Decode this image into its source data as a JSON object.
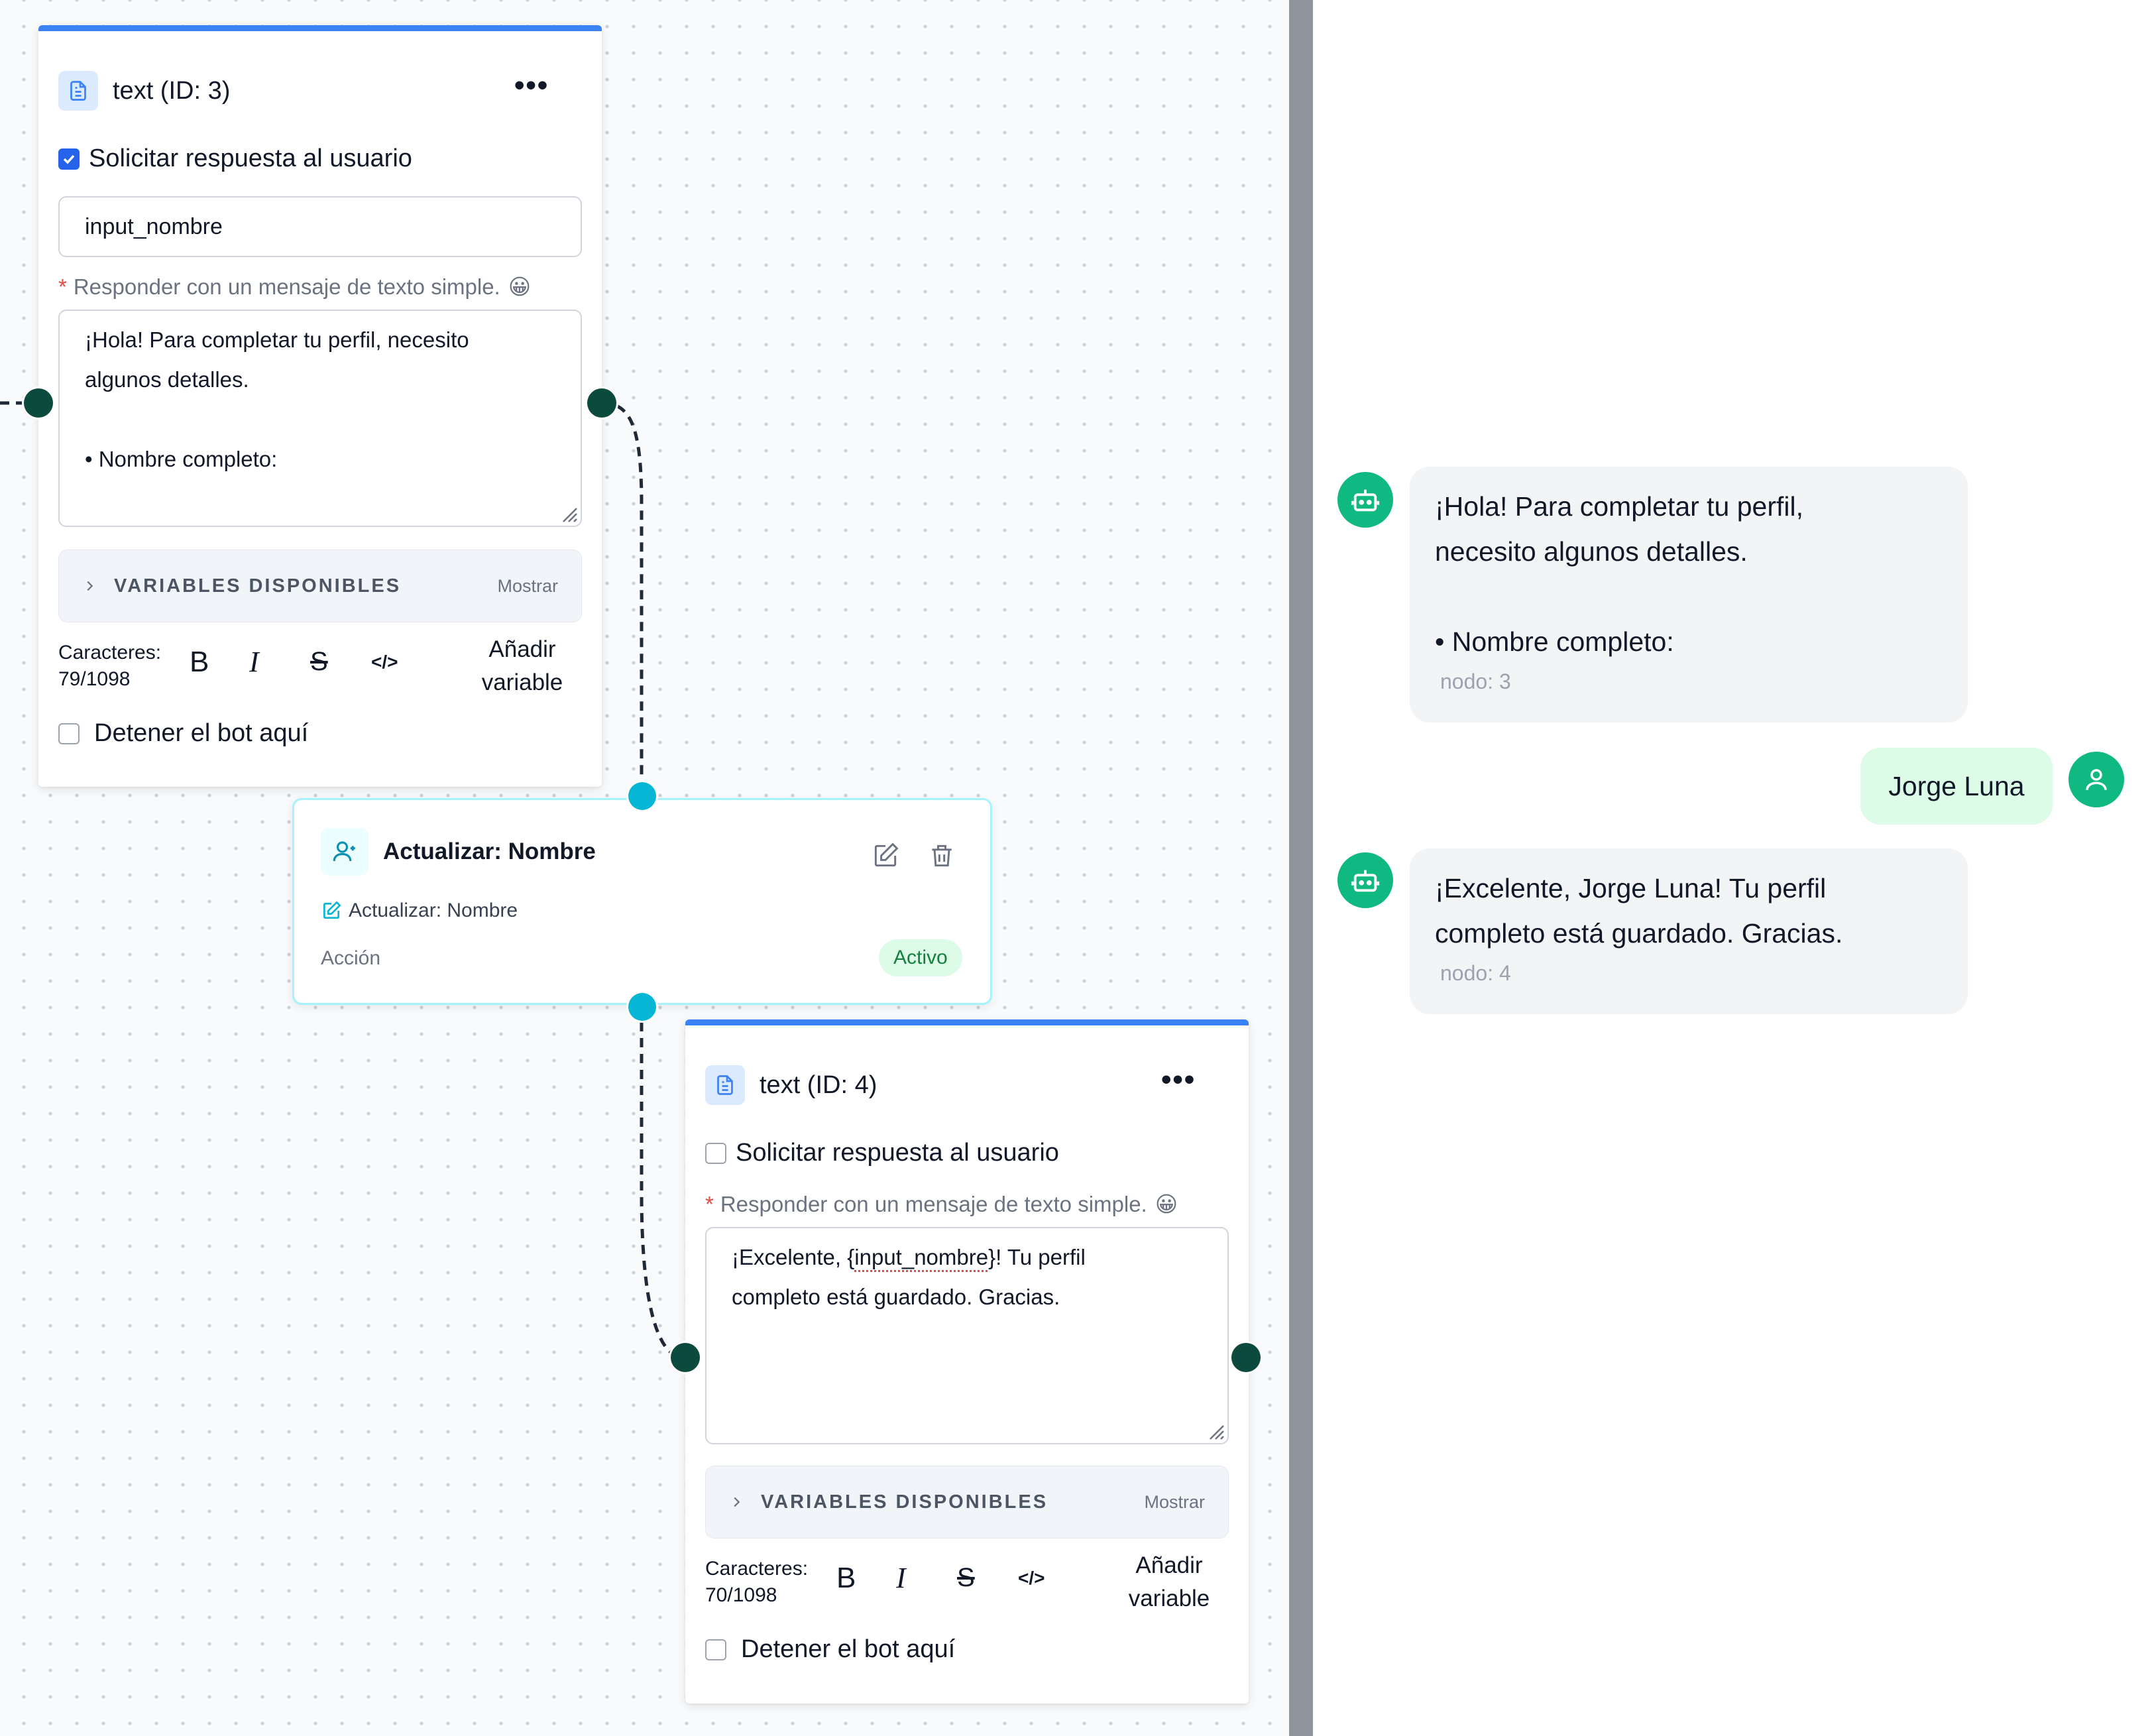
{
  "node3": {
    "title": "text (ID: 3)",
    "menu": "•••",
    "ask_label": "Solicitar respuesta al usuario",
    "ask_checked": true,
    "input_value": "input_nombre",
    "reply_label": "Responder con un mensaje de texto simple.",
    "emoji": "😀",
    "message": "¡Hola! Para completar tu perfil, necesito\nalgunos detalles.\n\n• Nombre completo:",
    "vars_title": "VARIABLES DISPONIBLES",
    "vars_toggle": "Mostrar",
    "chars_label": "Caracteres:",
    "chars_value": "79/1098",
    "add_var_line1": "Añadir",
    "add_var_line2": "variable",
    "stop_label": "Detener el bot aquí"
  },
  "action": {
    "title": "Actualizar: Nombre",
    "subtitle": "Actualizar: Nombre",
    "type": "Acción",
    "status": "Activo"
  },
  "node4": {
    "title": "text (ID: 4)",
    "menu": "•••",
    "ask_label": "Solicitar respuesta al usuario",
    "ask_checked": false,
    "reply_label": "Responder con un mensaje de texto simple.",
    "emoji": "😀",
    "message_pre": "¡Excelente, {",
    "message_var": "input_nombre",
    "message_post": "}! Tu perfil\ncompleto está guardado. Gracias.",
    "vars_title": "VARIABLES DISPONIBLES",
    "vars_toggle": "Mostrar",
    "chars_label": "Caracteres:",
    "chars_value": "70/1098",
    "add_var_line1": "Añadir",
    "add_var_line2": "variable",
    "stop_label": "Detener el bot aquí"
  },
  "chat": {
    "messages": [
      {
        "from": "bot",
        "text": "¡Hola! Para completar tu perfil,\nnecesito algunos detalles.\n\n• Nombre completo:",
        "meta": "nodo: 3"
      },
      {
        "from": "user",
        "text": "Jorge Luna"
      },
      {
        "from": "bot",
        "text": "¡Excelente, Jorge Luna! Tu perfil\ncompleto está guardado. Gracias.",
        "meta": "nodo: 4"
      }
    ]
  },
  "colors": {
    "accent_blue": "#3b82f6",
    "handle_dark": "#0b4a3c",
    "handle_cyan": "#06b6d4",
    "avatar_green": "#10b981",
    "divider": "#8e959c"
  }
}
